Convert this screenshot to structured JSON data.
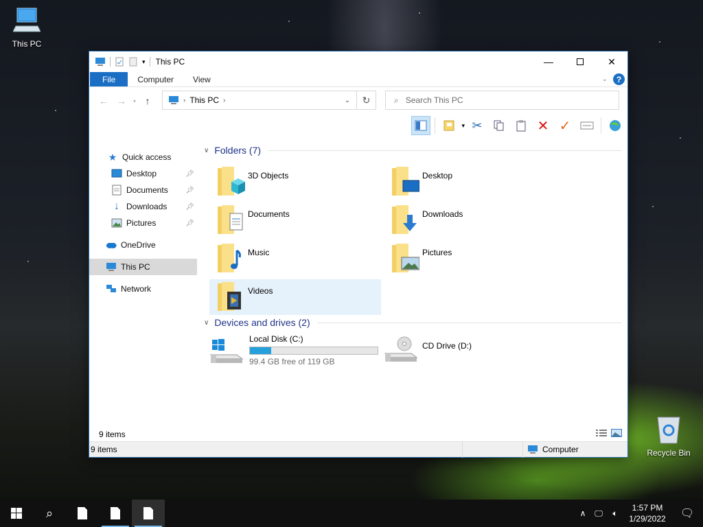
{
  "desktop": {
    "this_pc_label": "This PC",
    "recycle_bin_label": "Recycle Bin"
  },
  "window": {
    "title": "This PC",
    "ribbon_tabs": [
      {
        "label": "File"
      },
      {
        "label": "Computer"
      },
      {
        "label": "View"
      }
    ],
    "help_label": "?",
    "address": {
      "crumb": "This PC"
    },
    "search": {
      "placeholder": "Search This PC"
    },
    "nav": {
      "quick_access": "Quick access",
      "desktop": "Desktop",
      "documents": "Documents",
      "downloads": "Downloads",
      "pictures": "Pictures",
      "onedrive": "OneDrive",
      "this_pc": "This PC",
      "network": "Network"
    },
    "folders_header": "Folders (7)",
    "folders": [
      {
        "name": "3D Objects"
      },
      {
        "name": "Desktop"
      },
      {
        "name": "Documents"
      },
      {
        "name": "Downloads"
      },
      {
        "name": "Music"
      },
      {
        "name": "Pictures"
      },
      {
        "name": "Videos"
      }
    ],
    "devices_header": "Devices and drives (2)",
    "drives": [
      {
        "name": "Local Disk (C:)",
        "free_text": "99.4 GB free of 119 GB",
        "used_fraction": 0.165
      },
      {
        "name": "CD Drive (D:)"
      }
    ],
    "item_count": "9 items",
    "status_count": "9 items",
    "status_location": "Computer"
  },
  "taskbar": {
    "time": "1:57 PM",
    "date": "1/29/2022"
  },
  "colors": {
    "accent": "#1a6fc4",
    "selection": "#cce4f7",
    "drive_bar": "#26a0da",
    "section_header": "#1e3287"
  }
}
